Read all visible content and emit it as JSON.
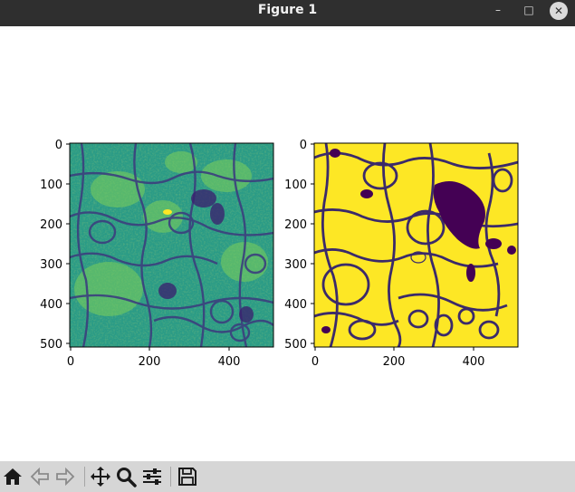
{
  "window": {
    "title": "Figure 1",
    "minimize_glyph": "–",
    "maximize_glyph": "□",
    "close_glyph": "✕"
  },
  "figure": {
    "panels": [
      {
        "name": "raw-image-panel",
        "colormap": "viridis",
        "x_ticks": [
          "0",
          "200",
          "400"
        ],
        "y_ticks": [
          "0",
          "100",
          "200",
          "300",
          "400",
          "500"
        ]
      },
      {
        "name": "segmentation-mask-panel",
        "colormap": "viridis-binary",
        "x_ticks": [
          "0",
          "200",
          "400"
        ],
        "y_ticks": [
          "0",
          "100",
          "200",
          "300",
          "400",
          "500"
        ]
      }
    ]
  },
  "toolbar": {
    "buttons": [
      {
        "name": "home-button",
        "icon": "home-icon"
      },
      {
        "name": "back-button",
        "icon": "arrow-left-icon"
      },
      {
        "name": "forward-button",
        "icon": "arrow-right-icon"
      },
      {
        "name": "pan-button",
        "icon": "move-icon"
      },
      {
        "name": "zoom-button",
        "icon": "magnifier-icon"
      },
      {
        "name": "configure-subplots-button",
        "icon": "sliders-icon"
      },
      {
        "name": "save-button",
        "icon": "floppy-disk-icon"
      }
    ]
  },
  "colors": {
    "titlebar": "#2f2f2f",
    "toolbar": "#d6d6d6",
    "viridis_dark": "#440154",
    "viridis_mid": "#21918c",
    "viridis_yellow": "#fde725"
  }
}
